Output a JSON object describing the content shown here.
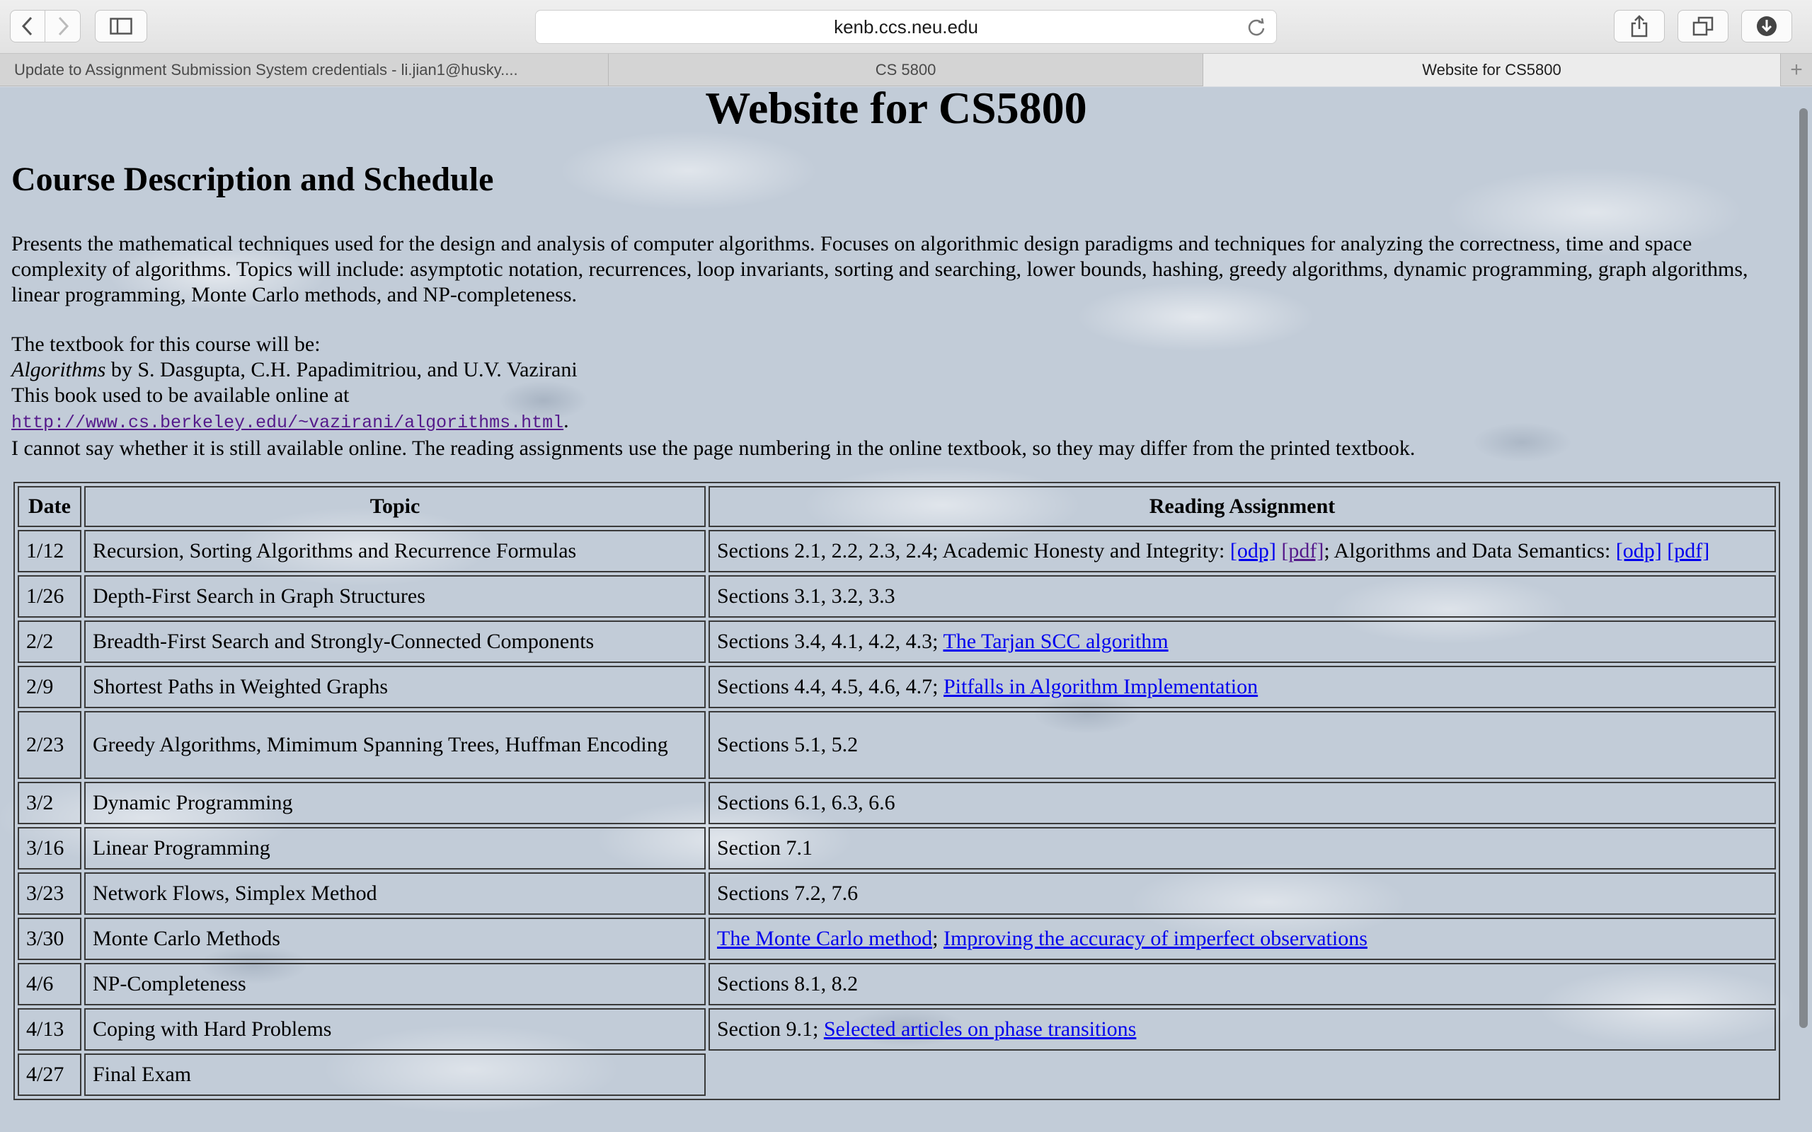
{
  "browser": {
    "url": "kenb.ccs.neu.edu",
    "tabs": [
      {
        "label": "Update to Assignment Submission System credentials - li.jian1@husky...."
      },
      {
        "label": "CS 5800"
      },
      {
        "label": "Website for CS5800"
      }
    ],
    "new_tab_symbol": "+"
  },
  "page": {
    "title": "Website for CS5800",
    "section_title": "Course Description and Schedule",
    "description": "Presents the mathematical techniques used for the design and analysis of computer algorithms. Focuses on algorithmic design paradigms and techniques for analyzing the correctness, time and space complexity of algorithms. Topics will include: asymptotic notation, recurrences, loop invariants, sorting and searching, lower bounds, hashing, greedy algorithms, dynamic programming, graph algorithms, linear programming, Monte Carlo methods, and NP-completeness.",
    "book_intro": "The textbook for this course will be:",
    "book_title": "Algorithms",
    "book_authors": " by S. Dasgupta, C.H. Papadimitriou, and U.V. Vazirani",
    "book_online_note": "This book used to be available online at",
    "book_url": "http://www.cs.berkeley.edu/~vazirani/algorithms.html",
    "book_url_suffix": ".",
    "book_disclaimer": "I cannot say whether it is still available online. The reading assignments use the page numbering in the online textbook, so they may differ from the printed textbook."
  },
  "schedule": {
    "headers": {
      "date": "Date",
      "topic": "Topic",
      "reading": "Reading Assignment"
    },
    "rows": [
      {
        "date": "1/12",
        "topic": "Recursion, Sorting Algorithms and Recurrence Formulas",
        "reading_text": "Sections 2.1, 2.2, 2.3, 2.4; Academic Honesty and Integrity: ",
        "link1": "[odp]",
        "link2": "[pdf]",
        "mid_text": "; Algorithms and Data Semantics: ",
        "link3": "[odp]",
        "link4": "[pdf]"
      },
      {
        "date": "1/26",
        "topic": "Depth-First Search in Graph Structures",
        "reading_text": "Sections 3.1, 3.2, 3.3"
      },
      {
        "date": "2/2",
        "topic": "Breadth-First Search and Strongly-Connected Components",
        "reading_text": "Sections 3.4, 4.1, 4.2, 4.3; ",
        "link1": "The Tarjan SCC algorithm"
      },
      {
        "date": "2/9",
        "topic": "Shortest Paths in Weighted Graphs",
        "reading_text": "Sections 4.4, 4.5, 4.6, 4.7; ",
        "link1": "Pitfalls in Algorithm Implementation"
      },
      {
        "date": "2/23",
        "topic": "Greedy Algorithms, Mimimum Spanning Trees, Huffman Encoding",
        "reading_text": "Sections 5.1, 5.2"
      },
      {
        "date": "3/2",
        "topic": "Dynamic Programming",
        "reading_text": "Sections 6.1, 6.3, 6.6"
      },
      {
        "date": "3/16",
        "topic": "Linear Programming",
        "reading_text": "Section 7.1"
      },
      {
        "date": "3/23",
        "topic": "Network Flows, Simplex Method",
        "reading_text": "Sections 7.2, 7.6"
      },
      {
        "date": "3/30",
        "topic": "Monte Carlo Methods",
        "link1": "The Monte Carlo method",
        "sep": "; ",
        "link2": "Improving the accuracy of imperfect observations"
      },
      {
        "date": "4/6",
        "topic": "NP-Completeness",
        "reading_text": "Sections 8.1, 8.2"
      },
      {
        "date": "4/13",
        "topic": "Coping with Hard Problems",
        "reading_text": "Section 9.1; ",
        "link1": "Selected articles on phase transitions"
      },
      {
        "date": "4/27",
        "topic": "Final Exam"
      }
    ]
  },
  "colors": {
    "link": "#0000ee",
    "visited_link": "#551a8b"
  }
}
